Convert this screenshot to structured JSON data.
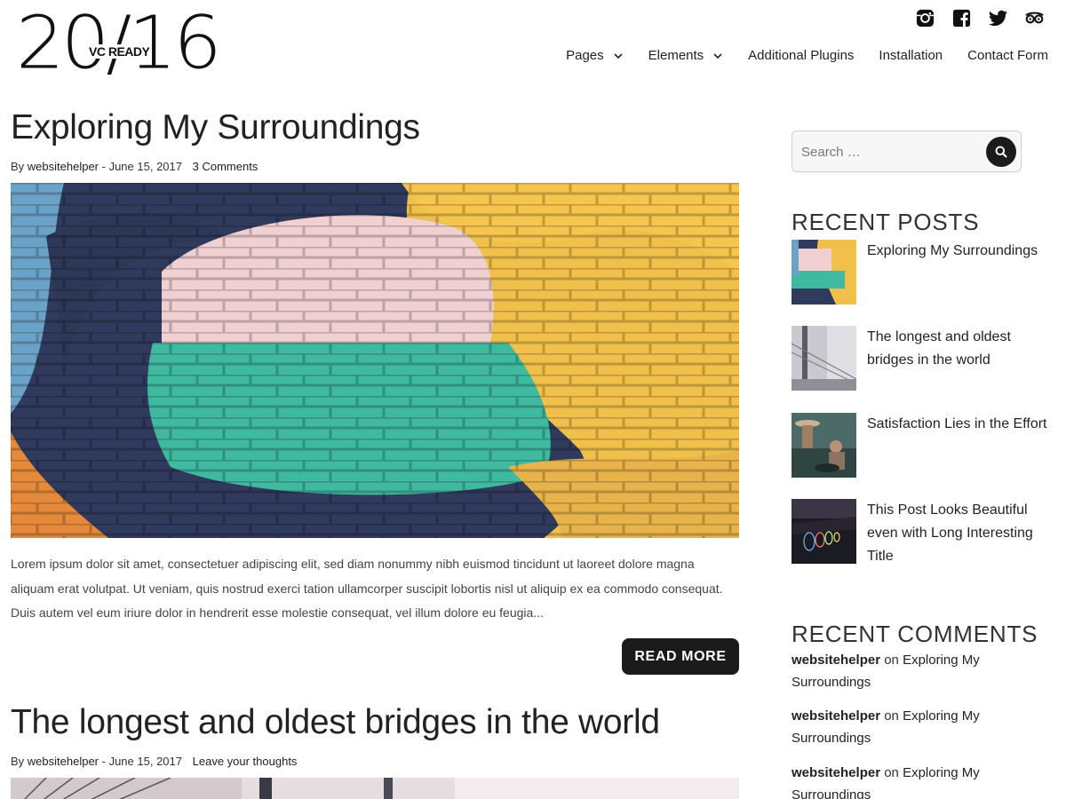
{
  "site": {
    "logo_big": "20/16",
    "logo_small": "VC READY"
  },
  "social": [
    {
      "icon": "instagram-icon"
    },
    {
      "icon": "facebook-icon"
    },
    {
      "icon": "twitter-icon"
    },
    {
      "icon": "tripadvisor-icon"
    }
  ],
  "nav": {
    "items": [
      {
        "label": "Pages",
        "has_dropdown": true
      },
      {
        "label": "Elements",
        "has_dropdown": true
      },
      {
        "label": "Additional Plugins",
        "has_dropdown": false
      },
      {
        "label": "Installation",
        "has_dropdown": false
      },
      {
        "label": "Contact Form",
        "has_dropdown": false
      }
    ]
  },
  "posts": [
    {
      "title": "Exploring My Surroundings",
      "by": "By",
      "author": "websitehelper",
      "date": "- June 15, 2017",
      "comments": "3 Comments",
      "excerpt": "Lorem ipsum dolor sit amet, consectetuer adipiscing elit, sed diam nonummy nibh euismod tincidunt ut laoreet dolore magna aliquam erat volutpat. Ut veniam, quis nostrud exerci tation ullamcorper suscipit lobortis nisl ut aliquip ex ea commodo consequat. Duis autem vel eum iriure dolor in hendrerit esse molestie consequat, vel illum dolore eu feugia...",
      "read_more": "READ MORE"
    },
    {
      "title": "The longest and oldest bridges in the world",
      "by": "By",
      "author": "websitehelper",
      "date": "- June 15, 2017",
      "comments": "Leave your thoughts"
    }
  ],
  "sidebar": {
    "search": {
      "placeholder": "Search …"
    },
    "recent_posts": {
      "title": "RECENT POSTS",
      "items": [
        {
          "title": "Exploring My Surroundings"
        },
        {
          "title": "The longest and oldest bridges in the world"
        },
        {
          "title": "Satisfaction Lies in the Effort"
        },
        {
          "title": "This Post Looks Beautiful even with Long Interesting Title"
        }
      ]
    },
    "recent_comments": {
      "title": "RECENT COMMENTS",
      "items": [
        {
          "author": "websitehelper",
          "on": "on",
          "post": "Exploring My Surroundings"
        },
        {
          "author": "websitehelper",
          "on": "on",
          "post": "Exploring My Surroundings"
        },
        {
          "author": "websitehelper",
          "on": "on",
          "post": "Exploring My Surroundings"
        }
      ]
    }
  },
  "colors": {
    "button_bg": "#1b1b1b",
    "text": "#222222",
    "mural_navy": "#2f3a5c",
    "mural_yellow": "#f0c04a",
    "mural_teal": "#3fb9a0",
    "mural_pink": "#f1d0d2"
  }
}
